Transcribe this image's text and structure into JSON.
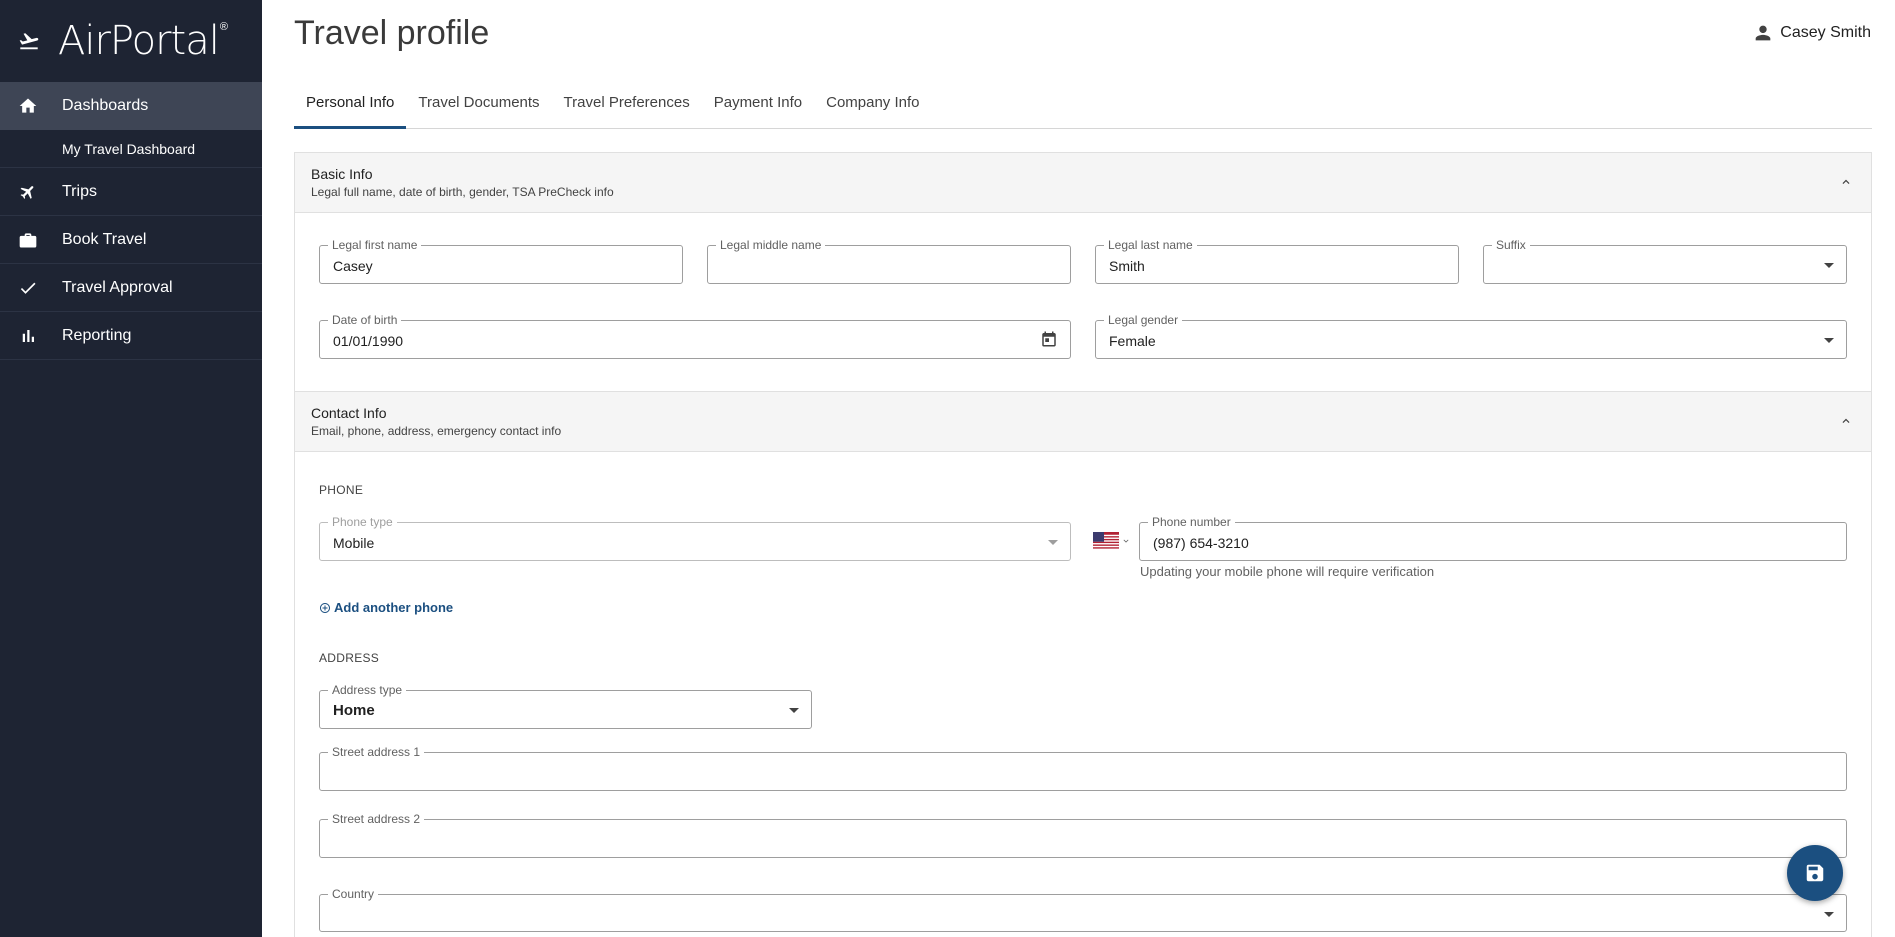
{
  "app": {
    "brand": "AirPortal",
    "brand_mark": "®"
  },
  "sidebar": {
    "items": [
      {
        "label": "Dashboards",
        "icon": "home-icon"
      },
      {
        "label": "My Travel Dashboard",
        "icon": ""
      },
      {
        "label": "Trips",
        "icon": "airplane-icon"
      },
      {
        "label": "Book Travel",
        "icon": "briefcase-icon"
      },
      {
        "label": "Travel Approval",
        "icon": "check-icon"
      },
      {
        "label": "Reporting",
        "icon": "bar-chart-icon"
      }
    ]
  },
  "header": {
    "title": "Travel profile",
    "user_name": "Casey Smith"
  },
  "tabs": [
    {
      "label": "Personal Info",
      "active": true
    },
    {
      "label": "Travel Documents",
      "active": false
    },
    {
      "label": "Travel Preferences",
      "active": false
    },
    {
      "label": "Payment Info",
      "active": false
    },
    {
      "label": "Company Info",
      "active": false
    }
  ],
  "basic_info": {
    "title": "Basic Info",
    "subtitle": "Legal full name, date of birth, gender, TSA PreCheck info",
    "first_name": {
      "label": "Legal first name",
      "value": "Casey"
    },
    "middle_name": {
      "label": "Legal middle name",
      "value": ""
    },
    "last_name": {
      "label": "Legal last name",
      "value": "Smith"
    },
    "suffix": {
      "label": "Suffix",
      "value": ""
    },
    "dob": {
      "label": "Date of birth",
      "value": "01/01/1990"
    },
    "gender": {
      "label": "Legal gender",
      "value": "Female"
    }
  },
  "contact_info": {
    "title": "Contact Info",
    "subtitle": "Email, phone, address, emergency contact info",
    "phone_heading": "PHONE",
    "phone_type": {
      "label": "Phone type",
      "value": "Mobile"
    },
    "phone_number": {
      "label": "Phone number",
      "value": "(987) 654-3210"
    },
    "phone_hint": "Updating your mobile phone will require verification",
    "add_phone": "Add another phone",
    "address_heading": "ADDRESS",
    "address_type": {
      "label": "Address type",
      "value": "Home"
    },
    "street1": {
      "label": "Street address 1",
      "value": ""
    },
    "street2": {
      "label": "Street address 2",
      "value": ""
    },
    "country": {
      "label": "Country",
      "value": ""
    }
  },
  "colors": {
    "sidebar_bg": "#1e2433",
    "accent": "#1b4f80"
  }
}
